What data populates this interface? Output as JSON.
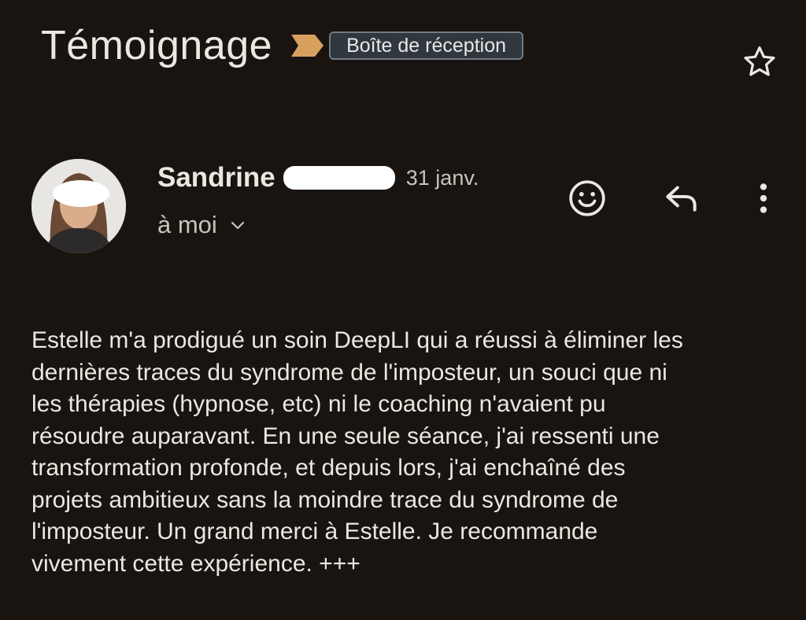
{
  "header": {
    "subject": "Témoignage",
    "label": "Boîte de réception",
    "star_icon": "star-outline-icon",
    "importance_icon": "importance-marker-icon",
    "colors": {
      "background": "#1a1411",
      "importance_marker": "#d8a05f",
      "label_border": "#6f7b86",
      "label_background": "#30373d",
      "text": "#ece7e1"
    }
  },
  "message": {
    "sender_name": "Sandrine",
    "date": "31 janv.",
    "recipient": "à moi",
    "actions": {
      "emoji_icon": "smiley-icon",
      "reply_icon": "reply-icon",
      "more_icon": "more-vertical-icon"
    },
    "body": "Estelle m'a prodigué un soin DeepLI qui a réussi à éliminer les\ndernières traces du syndrome de l'imposteur, un souci que ni\nles thérapies (hypnose, etc) ni le coaching n'avaient pu\nrésoudre auparavant. En une seule séance, j'ai ressenti une\ntransformation profonde, et depuis lors, j'ai enchaîné des\nprojets ambitieux sans la moindre trace du syndrome de\nl'imposteur. Un grand merci à Estelle. Je recommande\nvivement cette expérience. +++"
  }
}
